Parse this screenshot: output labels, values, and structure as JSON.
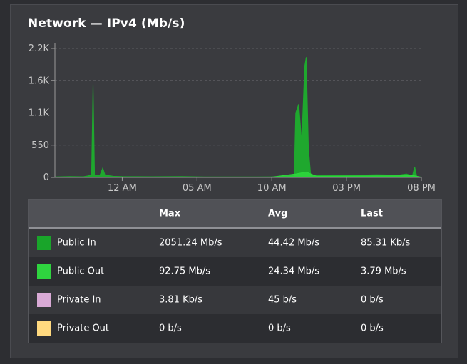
{
  "panel": {
    "title": "Network — IPv4 (Mb/s)"
  },
  "chart_data": {
    "type": "area",
    "title": "Network — IPv4 (Mb/s)",
    "y_ticks": [
      "0",
      "550",
      "1.1K",
      "1.6K",
      "2.2K"
    ],
    "y_tick_values": [
      0,
      550,
      1100,
      1650,
      2200
    ],
    "ylim": [
      0,
      2200
    ],
    "x_ticks": [
      "12 AM",
      "05 AM",
      "10 AM",
      "03 PM",
      "08 PM"
    ],
    "x_tick_hours": [
      0,
      5,
      10,
      15,
      20
    ],
    "xlim_hours": [
      -4.5,
      20
    ],
    "grid": true,
    "series": [
      {
        "name": "Public In",
        "color": "#1fa82e",
        "points": [
          [
            -4.5,
            10
          ],
          [
            -3.5,
            15
          ],
          [
            -2.6,
            12
          ],
          [
            -2.3,
            25
          ],
          [
            -2.05,
            40
          ],
          [
            -1.95,
            1600
          ],
          [
            -1.85,
            30
          ],
          [
            -1.5,
            30
          ],
          [
            -1.3,
            160
          ],
          [
            -1.15,
            40
          ],
          [
            -0.6,
            20
          ],
          [
            0,
            15
          ],
          [
            2,
            12
          ],
          [
            4,
            14
          ],
          [
            5.5,
            10
          ],
          [
            7,
            8
          ],
          [
            9,
            10
          ],
          [
            11,
            12
          ],
          [
            11.5,
            20
          ],
          [
            11.6,
            1100
          ],
          [
            11.8,
            1250
          ],
          [
            12.0,
            600
          ],
          [
            12.2,
            1900
          ],
          [
            12.3,
            2051
          ],
          [
            12.45,
            500
          ],
          [
            12.6,
            40
          ],
          [
            13.5,
            30
          ],
          [
            15,
            35
          ],
          [
            17,
            45
          ],
          [
            18.5,
            40
          ],
          [
            19.0,
            60
          ],
          [
            19.4,
            25
          ],
          [
            19.55,
            180
          ],
          [
            19.7,
            10
          ],
          [
            20,
            5
          ]
        ]
      },
      {
        "name": "Public Out",
        "color": "#2ed63d",
        "points": [
          [
            -4.5,
            5
          ],
          [
            0,
            6
          ],
          [
            10,
            6
          ],
          [
            11.6,
            60
          ],
          [
            12.3,
            92
          ],
          [
            13,
            20
          ],
          [
            19.5,
            30
          ],
          [
            20,
            4
          ]
        ]
      },
      {
        "name": "Private In",
        "color": "#d7a8d9",
        "points": [
          [
            -4.5,
            0
          ],
          [
            20,
            0
          ]
        ]
      },
      {
        "name": "Private Out",
        "color": "#ffd67a",
        "points": [
          [
            -4.5,
            0
          ],
          [
            20,
            0
          ]
        ]
      }
    ]
  },
  "legend": {
    "headers": {
      "name": "",
      "max": "Max",
      "avg": "Avg",
      "last": "Last"
    },
    "rows": [
      {
        "name": "Public In",
        "color": "#19a52a",
        "max": "2051.24 Mb/s",
        "avg": "44.42 Mb/s",
        "last": "85.31 Kb/s"
      },
      {
        "name": "Public Out",
        "color": "#2fd43f",
        "max": "92.75 Mb/s",
        "avg": "24.34 Mb/s",
        "last": "3.79 Mb/s"
      },
      {
        "name": "Private In",
        "color": "#d9aad6",
        "max": "3.81 Kb/s",
        "avg": "45 b/s",
        "last": "0 b/s"
      },
      {
        "name": "Private Out",
        "color": "#ffd97f",
        "max": "0 b/s",
        "avg": "0 b/s",
        "last": "0 b/s"
      }
    ]
  }
}
